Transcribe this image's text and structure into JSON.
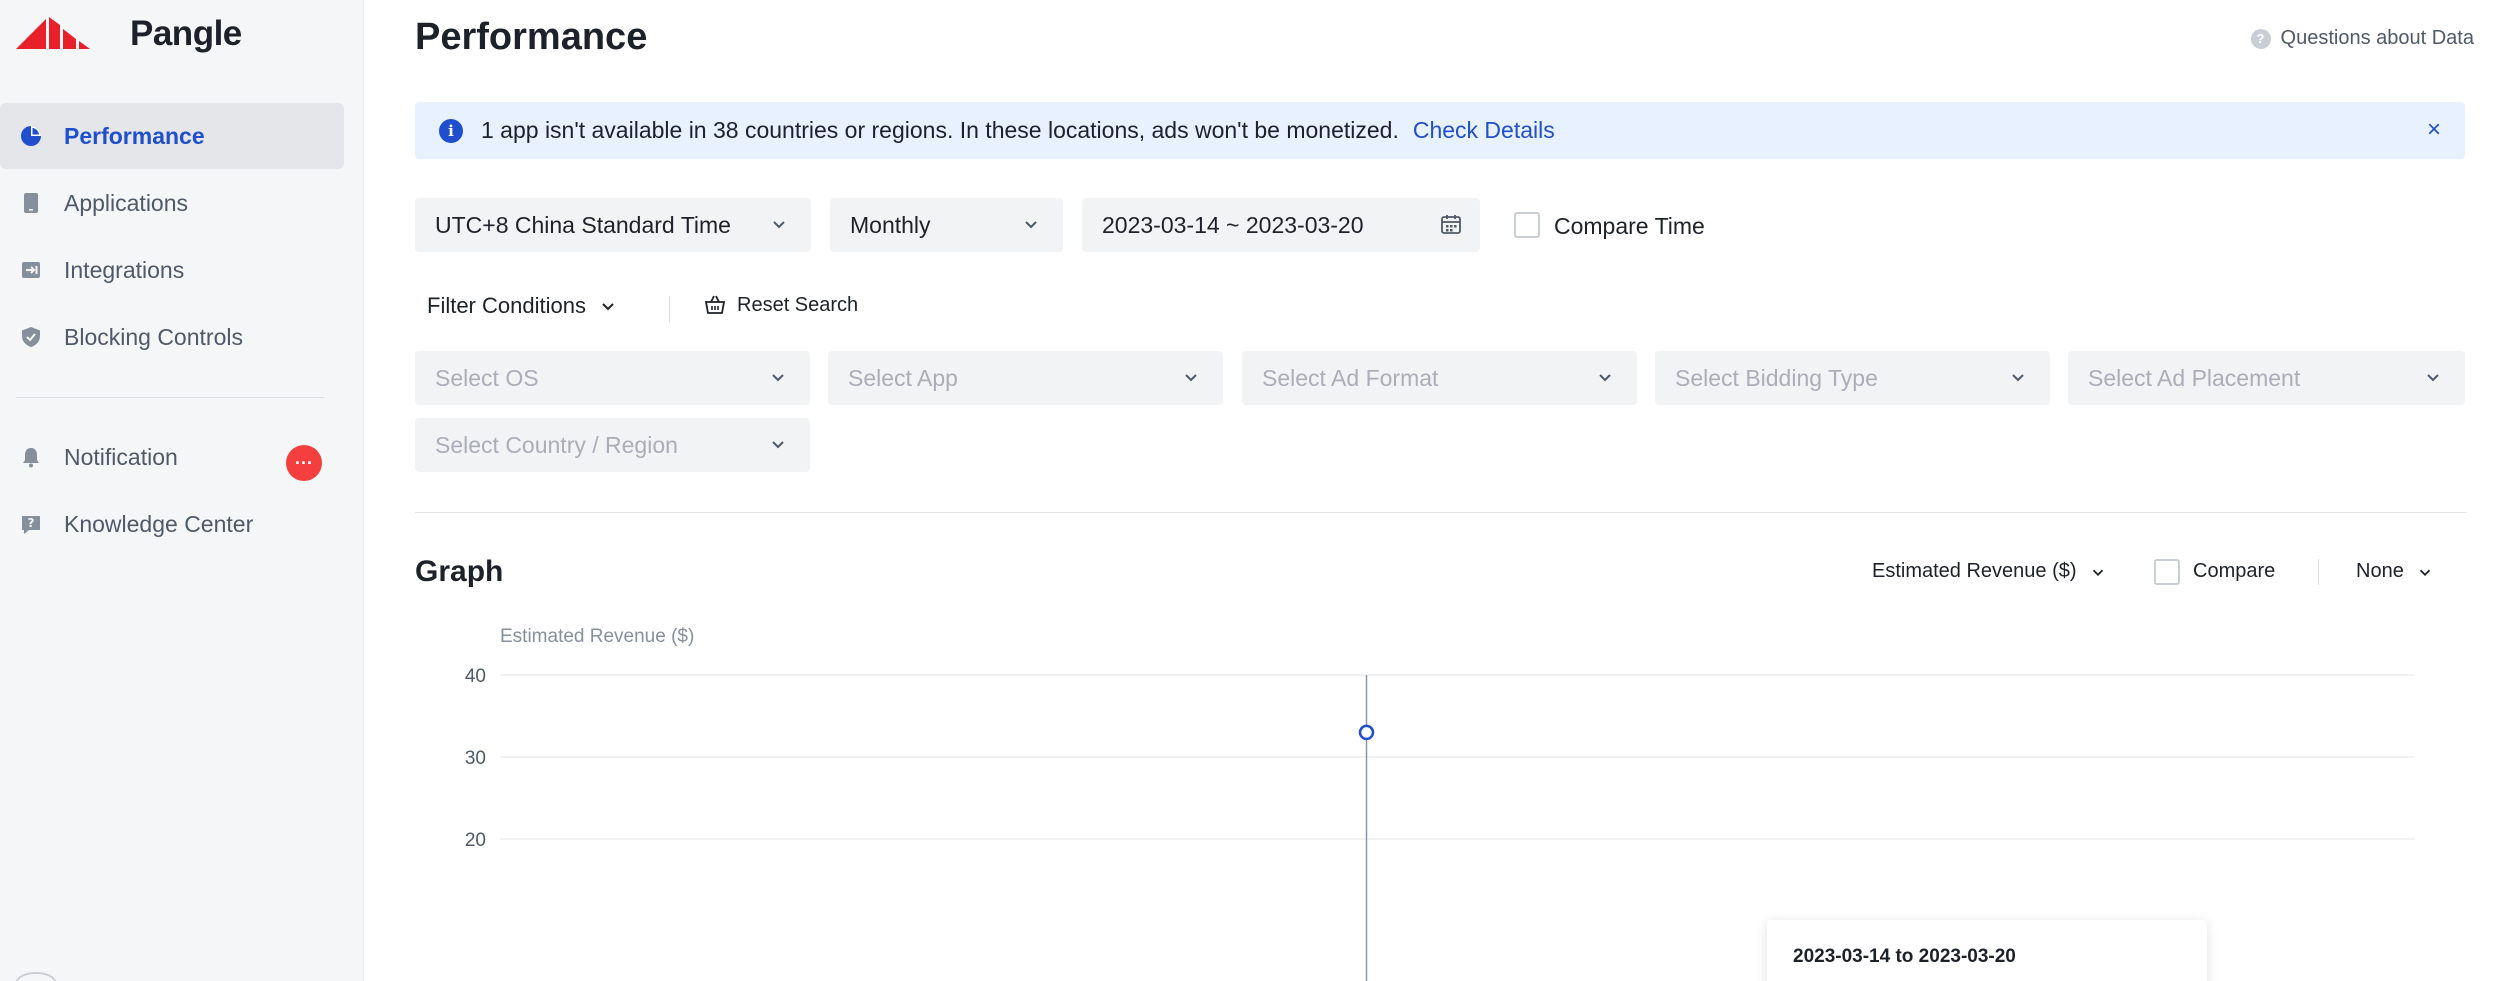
{
  "app": {
    "brand": "Pangle"
  },
  "sidebar": {
    "items": [
      {
        "label": "Performance",
        "icon": "pie-chart-icon",
        "active": true
      },
      {
        "label": "Applications",
        "icon": "phone-icon",
        "active": false
      },
      {
        "label": "Integrations",
        "icon": "integration-icon",
        "active": false
      },
      {
        "label": "Blocking Controls",
        "icon": "shield-icon",
        "active": false
      }
    ],
    "secondary": [
      {
        "label": "Notification",
        "icon": "bell-icon",
        "badge": "···"
      },
      {
        "label": "Knowledge Center",
        "icon": "question-icon"
      }
    ]
  },
  "header": {
    "title": "Performance",
    "help_link": "Questions about Data"
  },
  "banner": {
    "message": "1 app isn't available in 38 countries or regions. In these locations, ads won't be monetized.",
    "link": "Check Details",
    "close": "×"
  },
  "toolbar": {
    "timezone": "UTC+8 China Standard Time",
    "period": "Monthly",
    "date_range": "2023-03-14 ~ 2023-03-20",
    "compare_time_label": "Compare Time"
  },
  "filters": {
    "conditions_label": "Filter Conditions",
    "reset_label": "Reset Search",
    "placeholders": {
      "os": "Select OS",
      "app": "Select App",
      "ad_format": "Select Ad Format",
      "bidding_type": "Select Bidding Type",
      "ad_placement": "Select Ad Placement",
      "country": "Select Country / Region"
    }
  },
  "graph": {
    "title": "Graph",
    "metric": "Estimated Revenue ($)",
    "compare_label": "Compare",
    "breakdown": "None",
    "tooltip_title": "2023-03-14 to 2023-03-20"
  },
  "colors": {
    "accent": "#1f4fcc",
    "banner_bg": "#e8f1ff",
    "badge": "#f53f3f",
    "sidebar_bg": "#f5f6f8"
  },
  "chart_data": {
    "type": "line",
    "ylabel": "Estimated Revenue ($)",
    "y_ticks": [
      40,
      30,
      20
    ],
    "ylim": [
      20,
      40
    ],
    "series": [
      {
        "x": [
          "2023-03-14 to 2023-03-20"
        ],
        "values": [
          33
        ]
      }
    ],
    "grid": true
  }
}
